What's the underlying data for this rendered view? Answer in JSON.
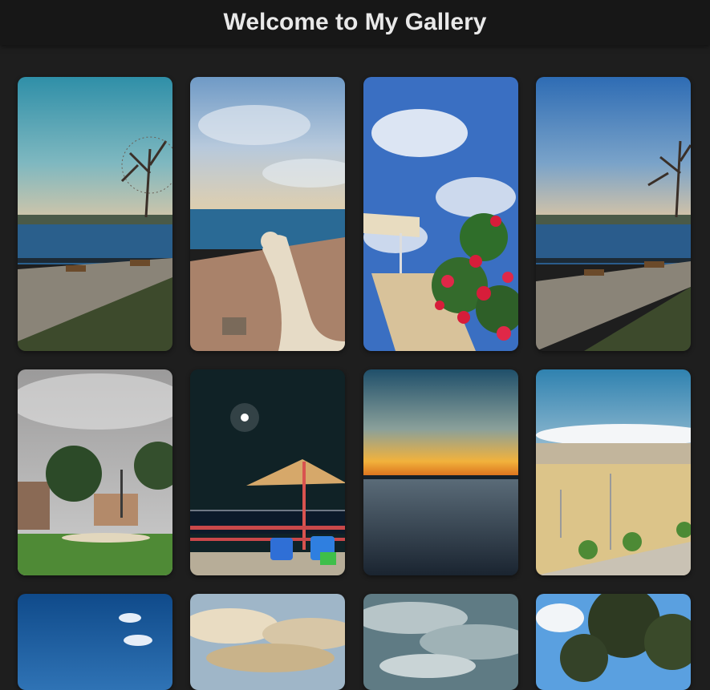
{
  "header": {
    "title": "Welcome to My Gallery"
  },
  "gallery": {
    "photos": [
      {
        "subject": "nile-river-promenade-tree"
      },
      {
        "subject": "camel-on-rocky-hill-river"
      },
      {
        "subject": "garden-sign-bougainvillea-flowers"
      },
      {
        "subject": "nile-river-promenade-tree"
      },
      {
        "subject": "cloudy-sky-palm-trees-building"
      },
      {
        "subject": "night-moon-umbrella-chairs"
      },
      {
        "subject": "sunset-over-water"
      },
      {
        "subject": "desert-sand-lamp-posts"
      },
      {
        "subject": "blue-sky-clouds"
      },
      {
        "subject": "golden-clouds-sky"
      },
      {
        "subject": "grey-clouds-sky"
      },
      {
        "subject": "tree-canopy-blue-sky"
      }
    ]
  }
}
